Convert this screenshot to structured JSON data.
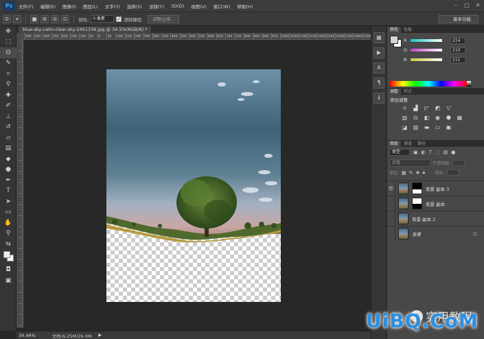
{
  "app": {
    "logo": "Ps"
  },
  "menu": [
    "文件(F)",
    "编辑(E)",
    "图像(I)",
    "图层(L)",
    "文字(Y)",
    "选择(S)",
    "滤镜(T)",
    "3D(D)",
    "视图(V)",
    "窗口(W)",
    "帮助(H)"
  ],
  "options": {
    "feather_label": "羽化:",
    "feather_value": "0 像素",
    "antialias_label": "消除锯齿",
    "refine_edge": "调整边缘...",
    "workspace": "基本功能"
  },
  "document": {
    "tab_title": "blue-sky-calm-clear-sky-2451336.jpg @ 34.5%(RGB/8) *",
    "ruler_marks": [
      "400",
      "350",
      "300",
      "250",
      "200",
      "150",
      "100",
      "50",
      "0",
      "50",
      "100",
      "150",
      "200",
      "250",
      "300",
      "350",
      "400",
      "450",
      "500",
      "550",
      "600",
      "650",
      "700",
      "750",
      "800",
      "850",
      "900",
      "950",
      "1000",
      "1050",
      "1100",
      "1150",
      "1200",
      "1250",
      "1300",
      "1350",
      "1400",
      "1450"
    ]
  },
  "status": {
    "zoom": "34.46%",
    "doc_size": "文档:6.25M/26.0M"
  },
  "color_panel": {
    "tabs": [
      "颜色",
      "色板"
    ],
    "channels": [
      {
        "label": "R",
        "value": "214",
        "gradient": "#16c7c9"
      },
      {
        "label": "G",
        "value": "210",
        "gradient": "#c93dc7"
      },
      {
        "label": "B",
        "value": "211",
        "gradient": "#c8c835"
      }
    ]
  },
  "adjust_panel": {
    "tabs": [
      "调整",
      "样式"
    ],
    "title": "添加调整"
  },
  "layers_panel": {
    "tabs": [
      "图层",
      "通道",
      "路径"
    ],
    "filter": "类型",
    "blend_mode": "正常",
    "opacity_label": "不透明度:",
    "lock_label": "锁定:",
    "fill_label": "填充:",
    "layers": [
      {
        "name": "背景 副本 3",
        "visible": true,
        "mask": true,
        "selected": false
      },
      {
        "name": "背景 副本",
        "visible": false,
        "mask": true,
        "selected": false
      },
      {
        "name": "背景 副本 2",
        "visible": false,
        "mask": false,
        "selected": false
      },
      {
        "name": "背景",
        "visible": false,
        "mask": false,
        "selected": false,
        "locked": true
      }
    ]
  },
  "watermark": {
    "text": "实用教程",
    "brand": "UiBQ.CoM"
  }
}
